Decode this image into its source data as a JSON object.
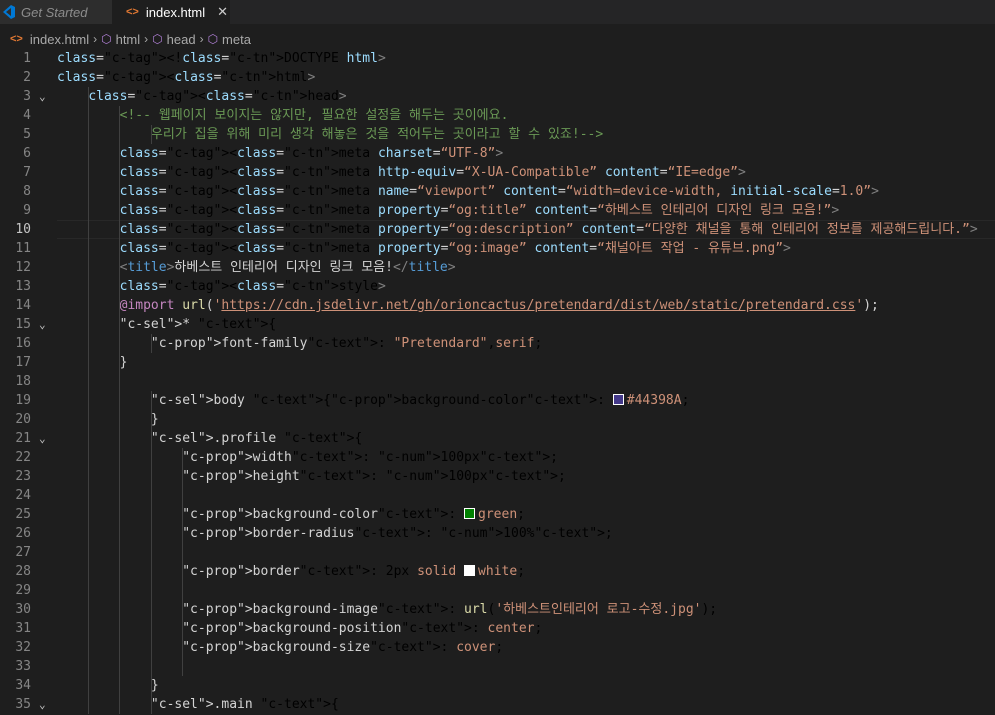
{
  "tabs": [
    {
      "label": "Get Started",
      "active": false,
      "icon": "vscode-icon"
    },
    {
      "label": "index.html",
      "active": true,
      "icon": "html-file-icon"
    }
  ],
  "breadcrumb": [
    "index.html",
    "html",
    "head",
    "meta"
  ],
  "colors": {
    "background": "#1e1e1e",
    "tag": "#569cd6",
    "attribute": "#9cdcfe",
    "string": "#ce9178",
    "comment": "#6a9955",
    "swatch_body": "#44398A",
    "swatch_green": "green",
    "swatch_white": "white"
  },
  "editor": {
    "current_line": 10,
    "lines": [
      {
        "n": "1",
        "t": "<!DOCTYPE html>"
      },
      {
        "n": "2",
        "t": "<html>"
      },
      {
        "n": "3",
        "t": "    <head>"
      },
      {
        "n": "4",
        "t": "        <!-- 웹페이지 보이지는 않지만, 필요한 설정을 해두는 곳이에요."
      },
      {
        "n": "5",
        "t": "            우리가 집을 위해 미리 생각 해놓은 것을 적어두는 곳이라고 할 수 있죠!-->"
      },
      {
        "n": "6",
        "t": "        <meta charset=“UTF-8”>"
      },
      {
        "n": "7",
        "t": "        <meta http-equiv=“X-UA-Compatible” content=“IE=edge”>"
      },
      {
        "n": "8",
        "t": "        <meta name=“viewport” content=“width=device-width, initial-scale=1.0”>"
      },
      {
        "n": "9",
        "t": "        <meta property=“og:title” content=“하베스트 인테리어 디자인 링크 모음!”>"
      },
      {
        "n": "10",
        "t": "        <meta property=“og:description” content=“다양한 채널을 통해 인테리어 정보를 제공해드립니다.”>"
      },
      {
        "n": "11",
        "t": "        <meta property=“og:image” content=“채널아트 작업 - 유튜브.png”>"
      },
      {
        "n": "12",
        "t": "        <title>하베스트 인테리어 디자인 링크 모음!</title>"
      },
      {
        "n": "13",
        "t": "        <style>"
      },
      {
        "n": "14",
        "t": "        @import url('https://cdn.jsdelivr.net/gh/orioncactus/pretendard/dist/web/static/pretendard.css');"
      },
      {
        "n": "15",
        "t": "        * {"
      },
      {
        "n": "16",
        "t": "            font-family: \"Pretendard\",serif;"
      },
      {
        "n": "17",
        "t": "        }"
      },
      {
        "n": "18",
        "t": ""
      },
      {
        "n": "19",
        "t": "            body {background-color: #44398A;"
      },
      {
        "n": "20",
        "t": "            }"
      },
      {
        "n": "21",
        "t": "            .profile {"
      },
      {
        "n": "22",
        "t": "                width: 100px;"
      },
      {
        "n": "23",
        "t": "                height: 100px;"
      },
      {
        "n": "24",
        "t": ""
      },
      {
        "n": "25",
        "t": "                background-color: green;"
      },
      {
        "n": "26",
        "t": "                border-radius: 100%;"
      },
      {
        "n": "27",
        "t": ""
      },
      {
        "n": "28",
        "t": "                border: 2px solid white;"
      },
      {
        "n": "29",
        "t": ""
      },
      {
        "n": "30",
        "t": "                background-image: url('하베스트인테리어 로고-수정.jpg');"
      },
      {
        "n": "31",
        "t": "                background-position: center;"
      },
      {
        "n": "32",
        "t": "                background-size: cover;"
      },
      {
        "n": "33",
        "t": ""
      },
      {
        "n": "34",
        "t": "            }"
      },
      {
        "n": "35",
        "t": "            .main {"
      }
    ]
  }
}
